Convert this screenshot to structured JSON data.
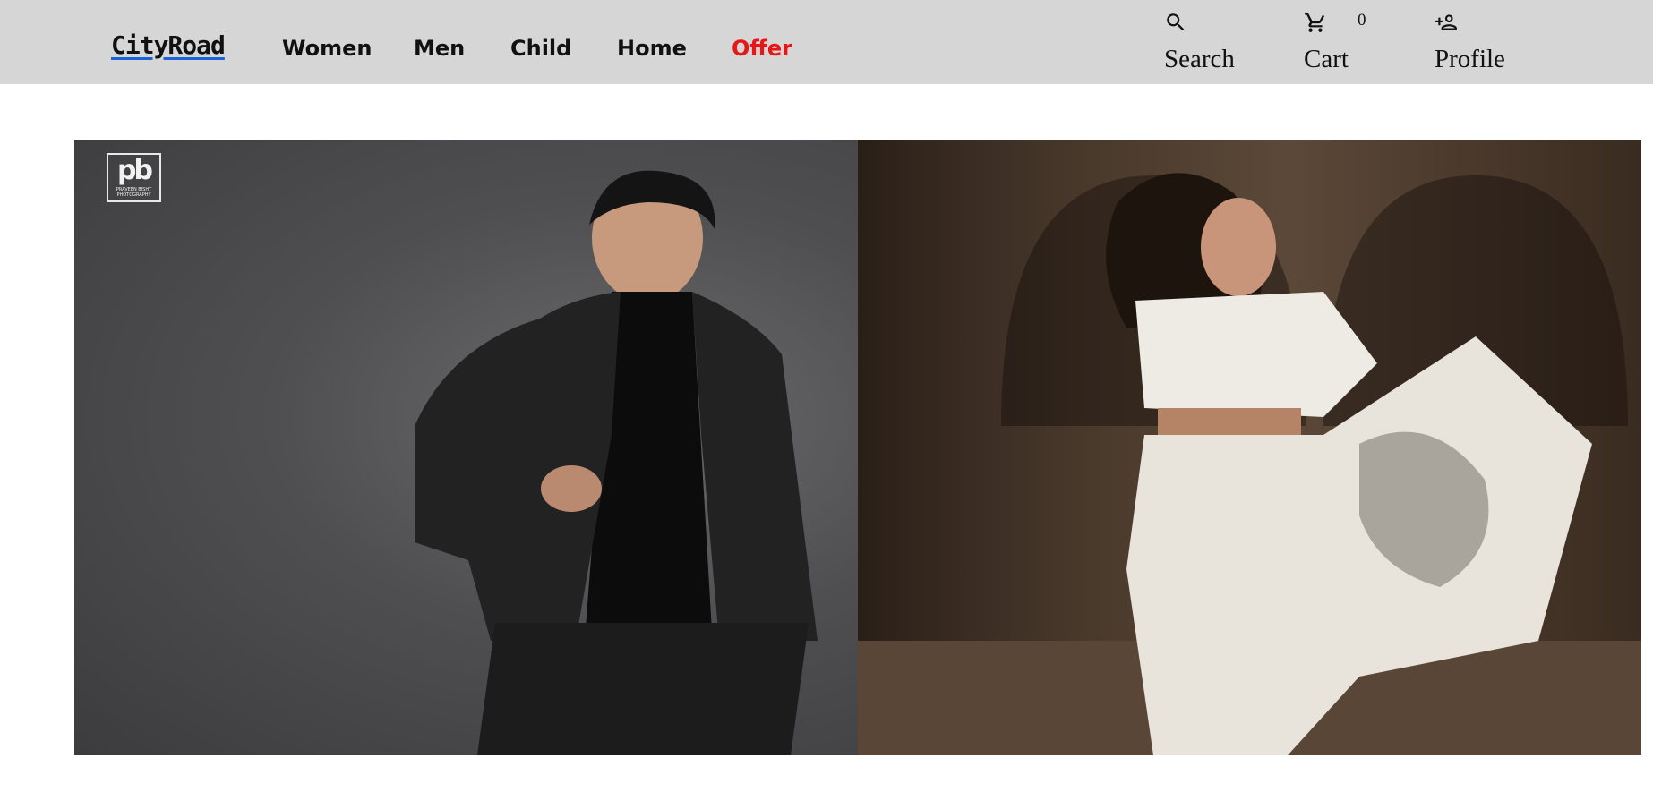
{
  "header": {
    "logo": "CityRoad",
    "nav": [
      "Women",
      "Men",
      "Child",
      "Home",
      "Offer"
    ],
    "tools": {
      "search": {
        "label": "Search",
        "icon": "search-icon"
      },
      "cart": {
        "label": "Cart",
        "icon": "cart-icon",
        "count": "0"
      },
      "profile": {
        "label": "Profile",
        "icon": "person-add-icon"
      }
    }
  },
  "hero": {
    "watermark": {
      "monogram": "pb",
      "text": "PRAVEEN BISHT PHOTOGRAPHY"
    }
  },
  "colors": {
    "topbar": "#d6d6d6",
    "offer": "#e81616",
    "logo_underline": "#1e63d6"
  }
}
